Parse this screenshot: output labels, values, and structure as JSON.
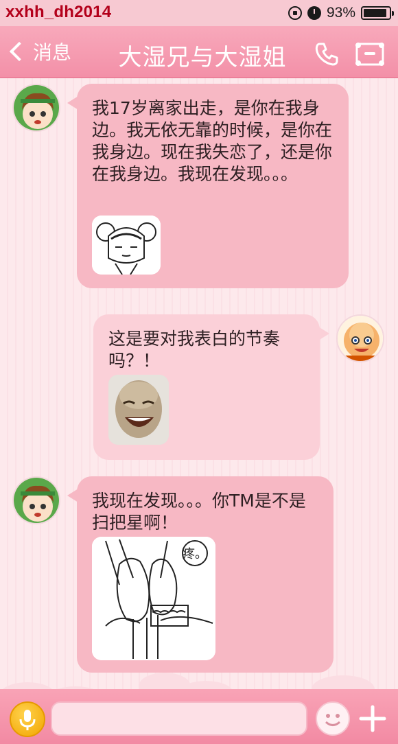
{
  "status_bar": {
    "watermark": "xxhh_dh2014",
    "battery_percent": "93%",
    "battery_level": 0.93
  },
  "nav": {
    "back_label": "消息",
    "title": "大湿兄与大湿姐"
  },
  "messages": [
    {
      "side": "incoming",
      "text": "我17岁离家出走，是你在我身边。我无依无靠的时候，是你在我身边。现在我失恋了，还是你在我身边。我现在发现。。。",
      "sticker": "manga-girl-sticker"
    },
    {
      "side": "outgoing",
      "text": "这是要对我表白的节奏吗？！",
      "sticker": "laughing-bald-man-sticker"
    },
    {
      "side": "incoming",
      "text": "我现在发现。。。你TM是不是扫把星啊！",
      "sticker": "comic-characters-sticker",
      "sticker_text": "疼。"
    }
  ],
  "input_bar": {
    "voice_icon": "microphone-icon",
    "emoji_icon": "smiley-icon",
    "plus_icon": "plus-icon"
  },
  "colors": {
    "nav_bg": "#f390a8",
    "incoming_bubble": "#f7b8c4",
    "outgoing_bubble": "#fbd0d8",
    "watermark": "#b3001b"
  }
}
